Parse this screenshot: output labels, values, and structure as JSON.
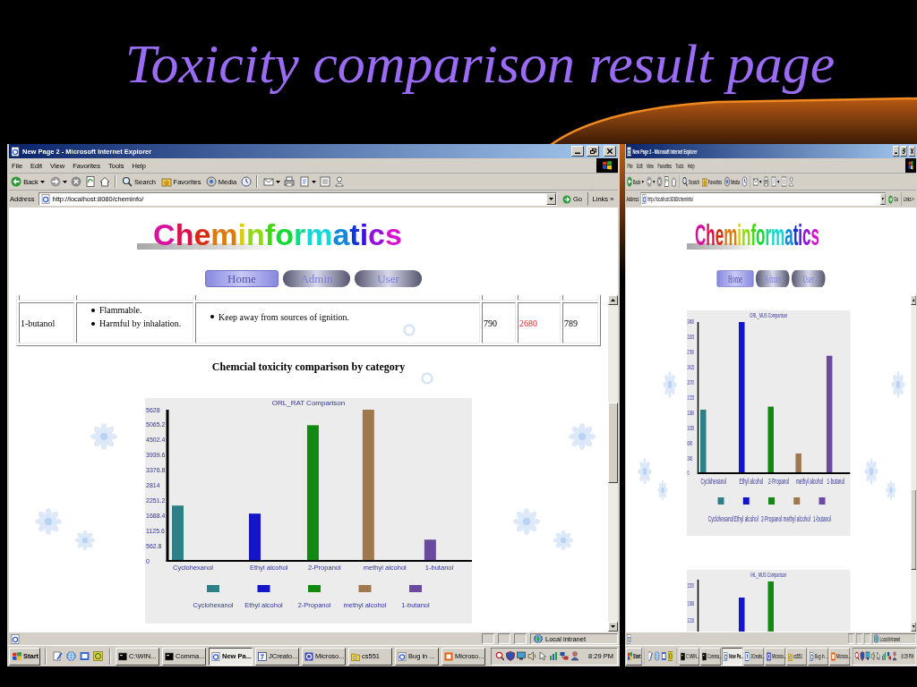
{
  "slide_title": "Toxicity comparison result page",
  "screens": [
    {
      "kind": "wide",
      "browser": {
        "title": "New Page 2 - Microsoft Internet Explorer",
        "menu": [
          "File",
          "Edit",
          "View",
          "Favorites",
          "Tools",
          "Help"
        ],
        "toolbar": [
          {
            "kind": "back",
            "label": "Back"
          },
          {
            "kind": "forward"
          },
          {
            "kind": "stop"
          },
          {
            "kind": "refresh"
          },
          {
            "kind": "home"
          },
          {
            "kind": "search",
            "label": "Search"
          },
          {
            "kind": "favorites",
            "label": "Favorites"
          },
          {
            "kind": "media",
            "label": "Media"
          },
          {
            "kind": "history"
          },
          {
            "kind": "mail"
          },
          {
            "kind": "print"
          },
          {
            "kind": "edit"
          },
          {
            "kind": "discuss"
          },
          {
            "kind": "messenger"
          }
        ],
        "address": {
          "label": "Address",
          "url": "http://localhost:8080/cheminfo/",
          "go": "Go",
          "links": "Links »"
        },
        "status": {
          "zone": "Local intranet"
        }
      },
      "page": {
        "logo": "Cheminformatics",
        "nav": [
          {
            "label": "Home",
            "selected": true
          },
          {
            "label": "Admin",
            "selected": false
          },
          {
            "label": "User",
            "selected": false
          }
        ],
        "blocks": [
          {
            "kind": "table",
            "rows": [
              {
                "cells": [
                  {
                    "kind": "text",
                    "text": "1-butanol"
                  },
                  {
                    "kind": "list",
                    "items": [
                      "Flammable.",
                      "Harmful by inhalation."
                    ]
                  },
                  {
                    "kind": "list",
                    "items": [
                      "Keep away from sources of ignition."
                    ]
                  },
                  {
                    "kind": "number",
                    "text": "790",
                    "highlighted": false
                  },
                  {
                    "kind": "number",
                    "text": "2680",
                    "highlighted": true
                  },
                  {
                    "kind": "number",
                    "text": "789",
                    "highlighted": false
                  }
                ]
              }
            ]
          },
          {
            "kind": "heading",
            "text": "Chemcial toxicity comparison by category"
          },
          {
            "kind": "chart",
            "chart_data": {
              "type": "bar",
              "title": "ORL_RAT Comparison",
              "categories": [
                "Cyclohexanol",
                "Ethyl alcohol",
                "2-Propanol",
                "methyl alcohol",
                "1-butanol"
              ],
              "values": [
                2060,
                1760,
                5050,
                5628,
                790
              ],
              "ylim": [
                0,
                5628
              ],
              "yticks": [
                0,
                562.8,
                1125.6,
                1688.4,
                2251.2,
                2814,
                3376.8,
                3939.6,
                4502.4,
                5065.2,
                5628
              ]
            },
            "legend": [
              {
                "label": "Cyclohexanol",
                "color": "#2f7f88"
              },
              {
                "label": "Ethyl alcohol",
                "color": "#1414c8"
              },
              {
                "label": "2-Propanol",
                "color": "#128a12"
              },
              {
                "label": "methyl alcohol",
                "color": "#a07850"
              },
              {
                "label": "1-butanol",
                "color": "#6a4a9e"
              }
            ]
          }
        ]
      },
      "taskbar": {
        "start": "Start",
        "tasks": [
          {
            "kind": "console",
            "label": "C:\\WIN...",
            "selected": false
          },
          {
            "kind": "console",
            "label": "Comma...",
            "selected": false
          },
          {
            "kind": "browser",
            "label": "New Pa...",
            "selected": true
          },
          {
            "kind": "editor",
            "label": "JCreato...",
            "selected": false
          },
          {
            "kind": "app",
            "label": "Microso...",
            "selected": false
          },
          {
            "kind": "folder",
            "label": "cs551",
            "selected": false
          },
          {
            "kind": "browser",
            "label": "Bug in ...",
            "selected": false
          },
          {
            "kind": "slides",
            "label": "Microso...",
            "selected": false
          }
        ],
        "clock": "8:29 PM"
      }
    },
    {
      "kind": "compact",
      "browser": {
        "title": "New Page 2 - Microsoft Internet Explorer",
        "menu": [
          "File",
          "Edit",
          "View",
          "Favorites",
          "Tools",
          "Help"
        ],
        "toolbar": [
          {
            "kind": "back",
            "label": "Back"
          },
          {
            "kind": "forward"
          },
          {
            "kind": "stop"
          },
          {
            "kind": "refresh"
          },
          {
            "kind": "home"
          },
          {
            "kind": "search",
            "label": "Search"
          },
          {
            "kind": "favorites",
            "label": "Favorites"
          },
          {
            "kind": "media",
            "label": "Media"
          },
          {
            "kind": "history"
          },
          {
            "kind": "mail"
          },
          {
            "kind": "print"
          },
          {
            "kind": "edit"
          },
          {
            "kind": "discuss"
          },
          {
            "kind": "messenger"
          }
        ],
        "address": {
          "label": "Address",
          "url": "http://localhost:8080/cheminfo/",
          "go": "Go",
          "links": "Links »"
        },
        "status": {
          "zone": "Local intranet"
        }
      },
      "page": {
        "logo": "Cheminformatics",
        "nav": [
          {
            "label": "Home",
            "selected": true
          },
          {
            "label": "Admin",
            "selected": false
          },
          {
            "label": "User",
            "selected": false
          }
        ],
        "blocks": [
          {
            "kind": "chart",
            "chart_data": {
              "type": "bar",
              "title": "ORL_MUS Comparison",
              "categories": [
                "Cyclohexanol",
                "Ethyl alcohol",
                "2-Propanol",
                "methyl alcohol",
                "1-butanol"
              ],
              "values": [
                1450,
                3450,
                1520,
                450,
                2680
              ],
              "ylim": [
                0,
                3450
              ],
              "yticks": [
                0,
                345,
                690,
                1035,
                1380,
                1725,
                2070,
                2415,
                2760,
                3105,
                3450
              ]
            },
            "legend": [
              {
                "label": "Cyclohexanol",
                "color": "#2f7f88"
              },
              {
                "label": "Ethyl alcohol",
                "color": "#1414c8"
              },
              {
                "label": "2-Propanol",
                "color": "#128a12"
              },
              {
                "label": "methyl alcohol",
                "color": "#a07850"
              },
              {
                "label": "1-butanol",
                "color": "#6a4a9e"
              }
            ]
          },
          {
            "kind": "chart_preview",
            "title": "IHL_MUS Comparison",
            "tick_labels": [
              "1520",
              "1368",
              "1216"
            ]
          }
        ]
      },
      "taskbar": {
        "start": "Start",
        "tasks": [
          {
            "kind": "console",
            "label": "C:\\WIN...",
            "selected": false
          },
          {
            "kind": "console",
            "label": "Comma...",
            "selected": false
          },
          {
            "kind": "browser",
            "label": "New Pa...",
            "selected": true
          },
          {
            "kind": "editor",
            "label": "JCreato...",
            "selected": false
          },
          {
            "kind": "app",
            "label": "Microso...",
            "selected": false
          },
          {
            "kind": "folder",
            "label": "cs551",
            "selected": false
          },
          {
            "kind": "browser",
            "label": "Bug in ...",
            "selected": false
          },
          {
            "kind": "slides",
            "label": "Microso...",
            "selected": false
          }
        ],
        "clock": "8:29 PM"
      }
    }
  ]
}
